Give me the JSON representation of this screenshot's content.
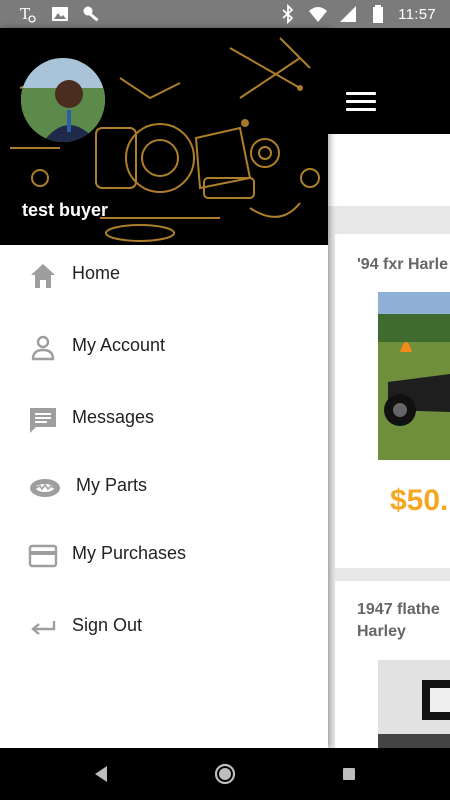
{
  "status_bar": {
    "time": "11:57",
    "left_icons": [
      "tmobile-icon",
      "image-icon",
      "key-icon"
    ],
    "right_icons": [
      "bluetooth-icon",
      "wifi-icon",
      "signal-icon",
      "battery-icon"
    ]
  },
  "drawer": {
    "user_name": "test buyer",
    "menu": [
      {
        "label": "Home",
        "icon": "home-icon"
      },
      {
        "label": "My Account",
        "icon": "person-icon"
      },
      {
        "label": "Messages",
        "icon": "message-icon"
      },
      {
        "label": "My Parts",
        "icon": "parts-icon"
      },
      {
        "label": "My Purchases",
        "icon": "credit-card-icon"
      },
      {
        "label": "Sign Out",
        "icon": "sign-out-arrow-icon"
      }
    ]
  },
  "listings": [
    {
      "title": "'94 fxr Harle",
      "price": "$50."
    },
    {
      "title": "1947 flathe Harley"
    }
  ],
  "colors": {
    "status_bar": "#7b7b7b",
    "header": "#000000",
    "price": "#f5a623",
    "icon_gray": "#9e9e9e"
  }
}
